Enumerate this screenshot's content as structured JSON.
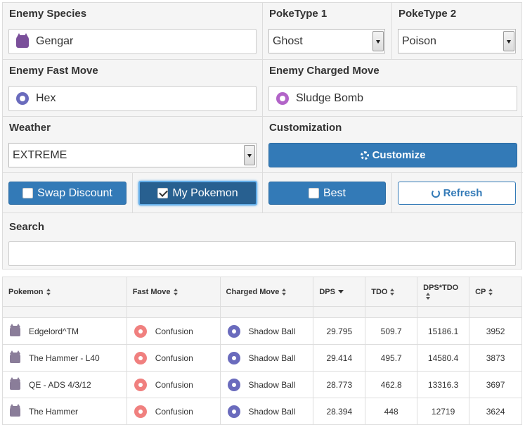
{
  "form": {
    "enemy_species_label": "Enemy Species",
    "enemy_species_value": "Gengar",
    "poketype1_label": "PokeType 1",
    "poketype1_value": "Ghost",
    "poketype2_label": "PokeType 2",
    "poketype2_value": "Poison",
    "fast_move_label": "Enemy Fast Move",
    "fast_move_value": "Hex",
    "charged_move_label": "Enemy Charged Move",
    "charged_move_value": "Sludge Bomb",
    "weather_label": "Weather",
    "weather_value": "EXTREME",
    "customization_label": "Customization",
    "customize_button": "Customize",
    "swap_discount_label": "Swap Discount",
    "my_pokemon_label": "My Pokemon",
    "best_label": "Best",
    "refresh_label": "Refresh",
    "search_label": "Search",
    "search_value": ""
  },
  "table": {
    "headers": [
      "Pokemon",
      "Fast Move",
      "Charged Move",
      "DPS",
      "TDO",
      "DPS*TDO",
      "CP"
    ],
    "rows": [
      {
        "pokemon": "Edgelord^TM",
        "fast": "Confusion",
        "charged": "Shadow Ball",
        "dps": "29.795",
        "tdo": "509.7",
        "dpstdo": "15186.1",
        "cp": "3952"
      },
      {
        "pokemon": "The Hammer - L40",
        "fast": "Confusion",
        "charged": "Shadow Ball",
        "dps": "29.414",
        "tdo": "495.7",
        "dpstdo": "14580.4",
        "cp": "3873"
      },
      {
        "pokemon": "QE - ADS 4/3/12",
        "fast": "Confusion",
        "charged": "Shadow Ball",
        "dps": "28.773",
        "tdo": "462.8",
        "dpstdo": "13316.3",
        "cp": "3697"
      },
      {
        "pokemon": "The Hammer",
        "fast": "Confusion",
        "charged": "Shadow Ball",
        "dps": "28.394",
        "tdo": "448",
        "dpstdo": "12719",
        "cp": "3624"
      }
    ]
  },
  "icons": {
    "species": "gengar-icon",
    "fast_move": "ghost-type-icon",
    "charged_move": "poison-type-icon",
    "row_pokemon": "pokemon-sprite-icon",
    "row_fast": "psychic-type-icon",
    "row_charged": "ghost-type-icon"
  },
  "colors": {
    "primary": "#337ab7",
    "ghost": "#6a6bbd",
    "poison": "#b264c8",
    "psychic": "#f0807f"
  }
}
